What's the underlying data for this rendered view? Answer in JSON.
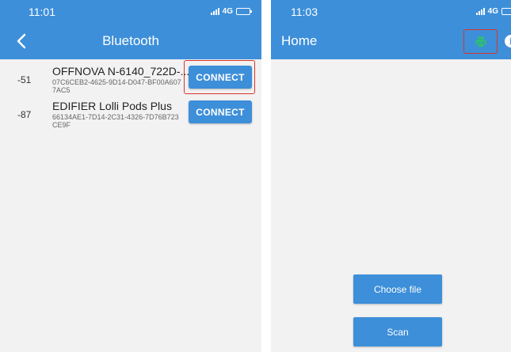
{
  "left_screen": {
    "status": {
      "time": "11:01",
      "network": "4G",
      "battery_level": 1.0
    },
    "title": "Bluetooth",
    "devices": [
      {
        "rssi": "-51",
        "name": "OFFNOVA N-6140_722D-...",
        "id": "07C6CEB2-4625-9D14-D047-BF00A6077AC5",
        "button": "CONNECT"
      },
      {
        "rssi": "-87",
        "name": "EDIFIER Lolli Pods Plus",
        "id": "66134AE1-7D14-2C31-4326-7D76B723CE9F",
        "button": "CONNECT"
      }
    ]
  },
  "right_screen": {
    "status": {
      "time": "11:03",
      "network": "4G",
      "battery_level": 1.0
    },
    "title": "Home",
    "icons": {
      "print": "printer-icon",
      "info": "info-icon"
    },
    "choose_file_label": "Choose file",
    "scan_label": "Scan"
  },
  "colors": {
    "primary": "#3d8fd9",
    "print_icon": "#2fbf71",
    "highlight": "#d9342b",
    "background": "#f2f2f2"
  }
}
